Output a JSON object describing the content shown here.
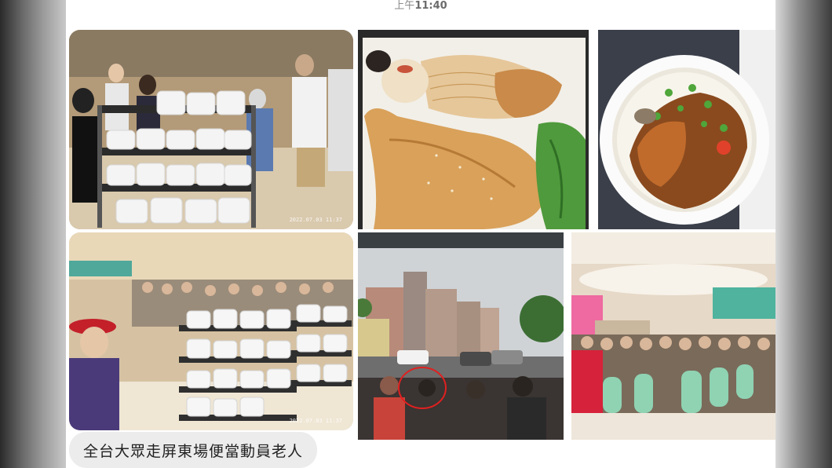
{
  "header": {
    "time_prefix": "上午",
    "time_value": "11:40"
  },
  "photos": [
    {
      "subject": "crowd collecting boxed meals from trolley",
      "timestamp": "2022.07.03 11:37"
    },
    {
      "subject": "lunch box with chicken leg, noodles, vegetables",
      "timestamp": ""
    },
    {
      "subject": "rice bowl with braised fish and scallions",
      "timestamp": ""
    },
    {
      "subject": "banquet hall with meal trolleys and crowd",
      "timestamp": "2022.07.03 11:37"
    },
    {
      "subject": "rainy street view, person circled in red",
      "timestamp": ""
    },
    {
      "subject": "seated audience in hall with green banner",
      "timestamp": ""
    }
  ],
  "caption": {
    "text": "全台大眾走屏東場便當動員老人"
  },
  "colors": {
    "bubble_bg": "#ececec",
    "chat_bg": "#ffffff",
    "circle": "#e02020"
  }
}
